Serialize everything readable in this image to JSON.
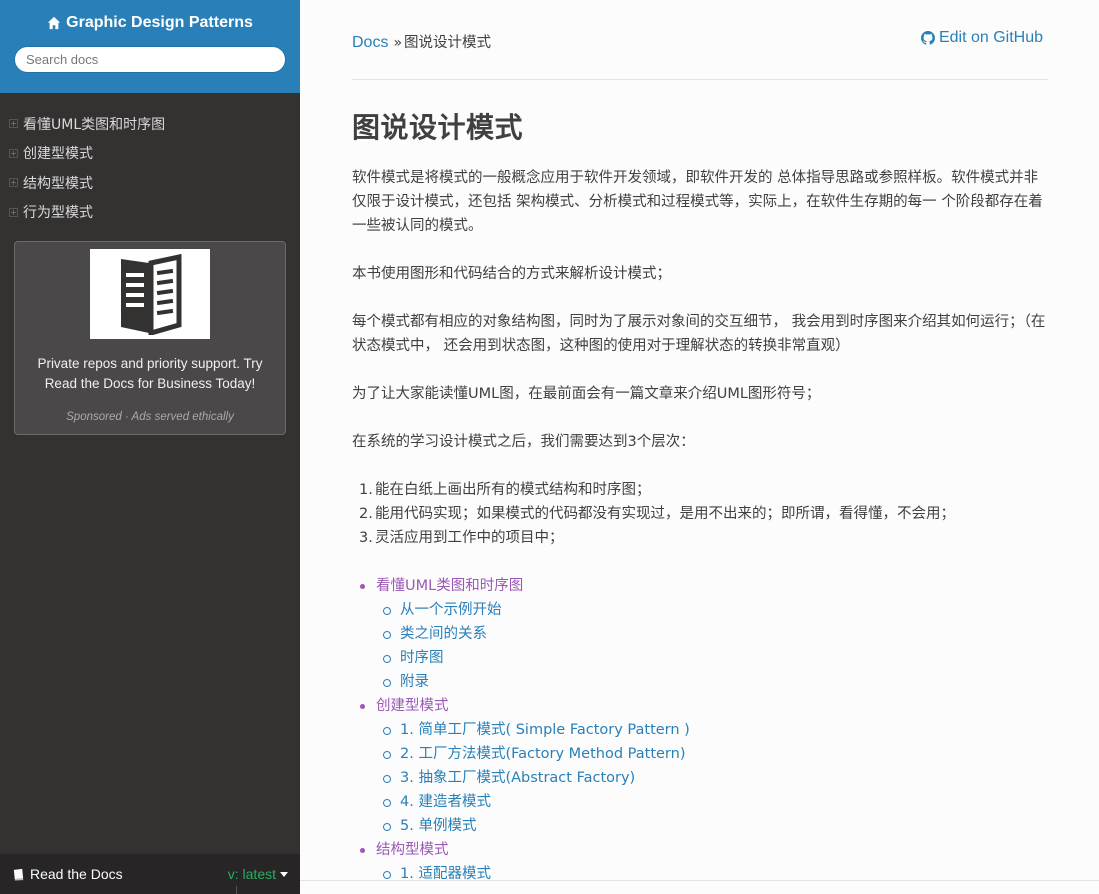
{
  "sidebar": {
    "brand": "Graphic Design Patterns",
    "search_placeholder": "Search docs",
    "nav": [
      {
        "label": "看懂UML类图和时序图"
      },
      {
        "label": "创建型模式"
      },
      {
        "label": "结构型模式"
      },
      {
        "label": "行为型模式"
      }
    ],
    "ad": {
      "text": "Private repos and priority support. Try Read the Docs for Business Today!",
      "sponsor": "Sponsored · Ads served ethically"
    },
    "footer": {
      "rtd_label": "Read the Docs",
      "version": "v: latest"
    }
  },
  "breadcrumb": {
    "home": "Docs",
    "separator": "»",
    "current": "图说设计模式",
    "edit_label": "Edit on GitHub"
  },
  "main": {
    "title": "图说设计模式",
    "paragraphs": [
      "软件模式是将模式的一般概念应用于软件开发领域，即软件开发的 总体指导思路或参照样板。软件模式并非仅限于设计模式，还包括 架构模式、分析模式和过程模式等，实际上，在软件生存期的每一 个阶段都存在着一些被认同的模式。",
      "本书使用图形和代码结合的方式来解析设计模式；",
      "每个模式都有相应的对象结构图，同时为了展示对象间的交互细节， 我会用到时序图来介绍其如何运行；（在状态模式中， 还会用到状态图，这种图的使用对于理解状态的转换非常直观）",
      "为了让大家能读懂UML图，在最前面会有一篇文章来介绍UML图形符号；",
      "在系统的学习设计模式之后，我们需要达到3个层次："
    ],
    "levels": [
      {
        "num": "1.",
        "text": "能在白纸上画出所有的模式结构和时序图；"
      },
      {
        "num": "2.",
        "text": "能用代码实现；如果模式的代码都没有实现过，是用不出来的；即所谓，看得懂，不会用；"
      },
      {
        "num": "3.",
        "text": "灵活应用到工作中的项目中；"
      }
    ],
    "toc": [
      {
        "label": "看懂UML类图和时序图",
        "children": [
          "从一个示例开始",
          "类之间的关系",
          "时序图",
          "附录"
        ]
      },
      {
        "label": "创建型模式",
        "children": [
          "1. 简单工厂模式( Simple Factory Pattern )",
          "2. 工厂方法模式(Factory Method Pattern)",
          "3. 抽象工厂模式(Abstract Factory)",
          "4. 建造者模式",
          "5. 单例模式"
        ]
      },
      {
        "label": "结构型模式",
        "children": [
          "1. 适配器模式"
        ]
      }
    ]
  },
  "colors": {
    "brand_blue": "#2980b9",
    "sidebar_bg": "#343131",
    "toc_purple": "#9b59b6",
    "version_green": "#27ae60"
  }
}
